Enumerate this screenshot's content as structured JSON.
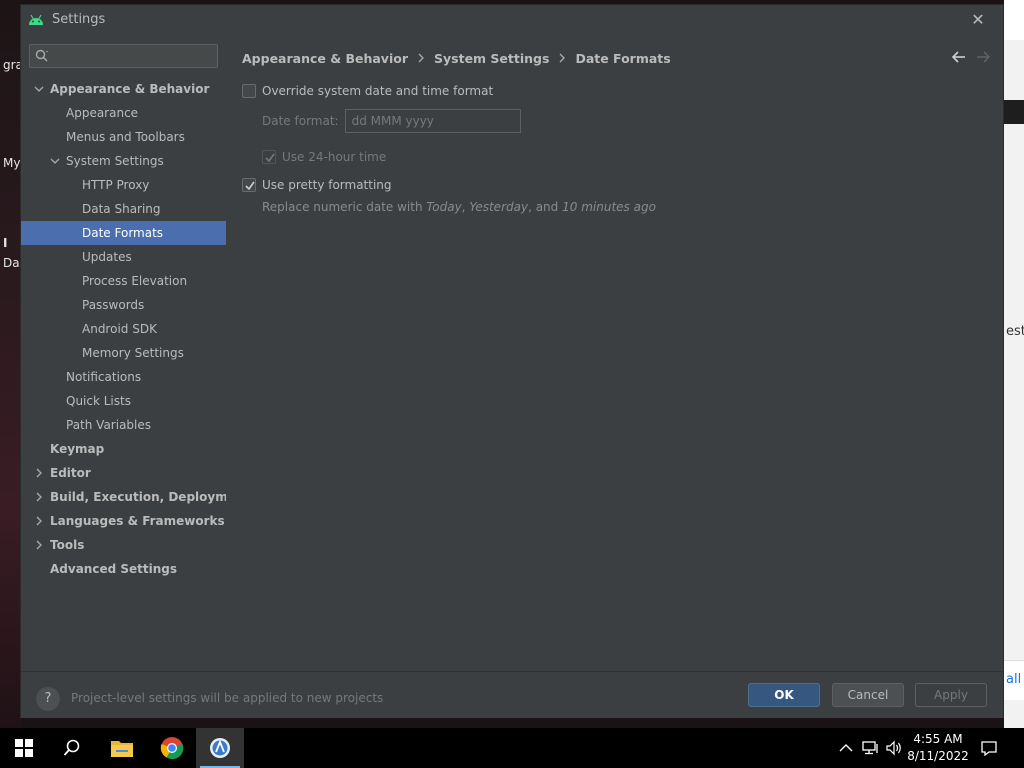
{
  "window": {
    "title": "Settings",
    "close_glyph": "✕"
  },
  "search": {
    "placeholder": "",
    "value": ""
  },
  "sidebar": {
    "items": [
      {
        "label": "Appearance & Behavior",
        "level": 0,
        "bold": true,
        "expand": "expanded"
      },
      {
        "label": "Appearance",
        "level": 1
      },
      {
        "label": "Menus and Toolbars",
        "level": 1
      },
      {
        "label": "System Settings",
        "level": 1,
        "expand": "expanded"
      },
      {
        "label": "HTTP Proxy",
        "level": 2
      },
      {
        "label": "Data Sharing",
        "level": 2
      },
      {
        "label": "Date Formats",
        "level": 2,
        "selected": true
      },
      {
        "label": "Updates",
        "level": 2
      },
      {
        "label": "Process Elevation",
        "level": 2
      },
      {
        "label": "Passwords",
        "level": 2
      },
      {
        "label": "Android SDK",
        "level": 2
      },
      {
        "label": "Memory Settings",
        "level": 2
      },
      {
        "label": "Notifications",
        "level": 1
      },
      {
        "label": "Quick Lists",
        "level": 1
      },
      {
        "label": "Path Variables",
        "level": 1
      },
      {
        "label": "Keymap",
        "level": 0,
        "bold": true
      },
      {
        "label": "Editor",
        "level": 0,
        "bold": true,
        "expand": "collapsed"
      },
      {
        "label": "Build, Execution, Deployment",
        "level": 0,
        "bold": true,
        "expand": "collapsed"
      },
      {
        "label": "Languages & Frameworks",
        "level": 0,
        "bold": true,
        "expand": "collapsed"
      },
      {
        "label": "Tools",
        "level": 0,
        "bold": true,
        "expand": "collapsed"
      },
      {
        "label": "Advanced Settings",
        "level": 0,
        "bold": true
      }
    ]
  },
  "breadcrumb": [
    "Appearance & Behavior",
    "System Settings",
    "Date Formats"
  ],
  "options": {
    "override_label": "Override system date and time format",
    "override_checked": false,
    "date_format_label": "Date format:",
    "date_format_value": "dd MMM yyyy",
    "use_24h_label": "Use 24-hour time",
    "use_24h_checked": true,
    "pretty_label": "Use pretty formatting",
    "pretty_checked": true,
    "pretty_hint_prefix": "Replace numeric date with",
    "pretty_hint_today": "Today",
    "pretty_hint_comma": ",",
    "pretty_hint_yesterday": "Yesterday",
    "pretty_hint_and": ", and",
    "pretty_hint_minutes": "10 minutes ago"
  },
  "footer": {
    "help_glyph": "?",
    "note": "Project-level settings will be applied to new projects",
    "ok": "OK",
    "cancel": "Cancel",
    "apply": "Apply"
  },
  "desktop": {
    "left_fragments": [
      "gra",
      "My",
      "I",
      "Da"
    ],
    "right_fragments": [
      "est",
      "all"
    ]
  },
  "taskbar": {
    "time": "4:55 AM",
    "date": "8/11/2022",
    "icons": [
      "windows-start-icon",
      "search-icon",
      "file-explorer-icon",
      "chrome-icon",
      "android-studio-icon"
    ]
  },
  "colors": {
    "accent": "#4b6eaf",
    "ok_button": "#365880",
    "android_green": "#3ddc84",
    "panel": "#3c3f41"
  }
}
